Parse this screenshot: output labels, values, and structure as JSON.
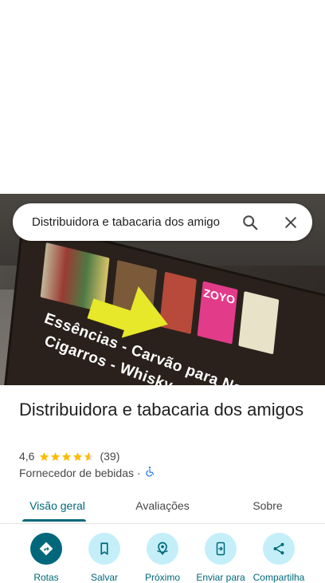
{
  "search": {
    "query": "Distribuidora e tabacaria dos amigo",
    "search_icon": "search-icon",
    "close_icon": "close-icon"
  },
  "photo": {
    "sign_line_1": "Essências - Carvão para Na",
    "sign_line_2": "Cigarros - Whisky - B",
    "brand_zoyo": "ZOYO"
  },
  "place": {
    "name": "Distribuidora e tabacaria dos amigos",
    "rating": "4,6",
    "stars_value": 4.6,
    "review_count": "(39)",
    "category": "Fornecedor de bebidas",
    "separator": "·",
    "accessibility_icon": "wheelchair-icon"
  },
  "tabs": [
    {
      "label": "Visão geral",
      "active": true
    },
    {
      "label": "Avaliações",
      "active": false
    },
    {
      "label": "Sobre",
      "active": false
    }
  ],
  "actions": [
    {
      "label": "Rotas",
      "icon": "directions-icon"
    },
    {
      "label": "Salvar",
      "icon": "bookmark-icon"
    },
    {
      "label": "Próximo",
      "icon": "nearby-icon"
    },
    {
      "label": "Enviar para",
      "icon": "send-to-phone-icon"
    },
    {
      "label": "Compartilha",
      "icon": "share-icon"
    }
  ],
  "colors": {
    "accent": "#00687a",
    "action_bg": "#c4eff9",
    "star": "#fbbc04",
    "accessibility": "#1a73e8"
  }
}
